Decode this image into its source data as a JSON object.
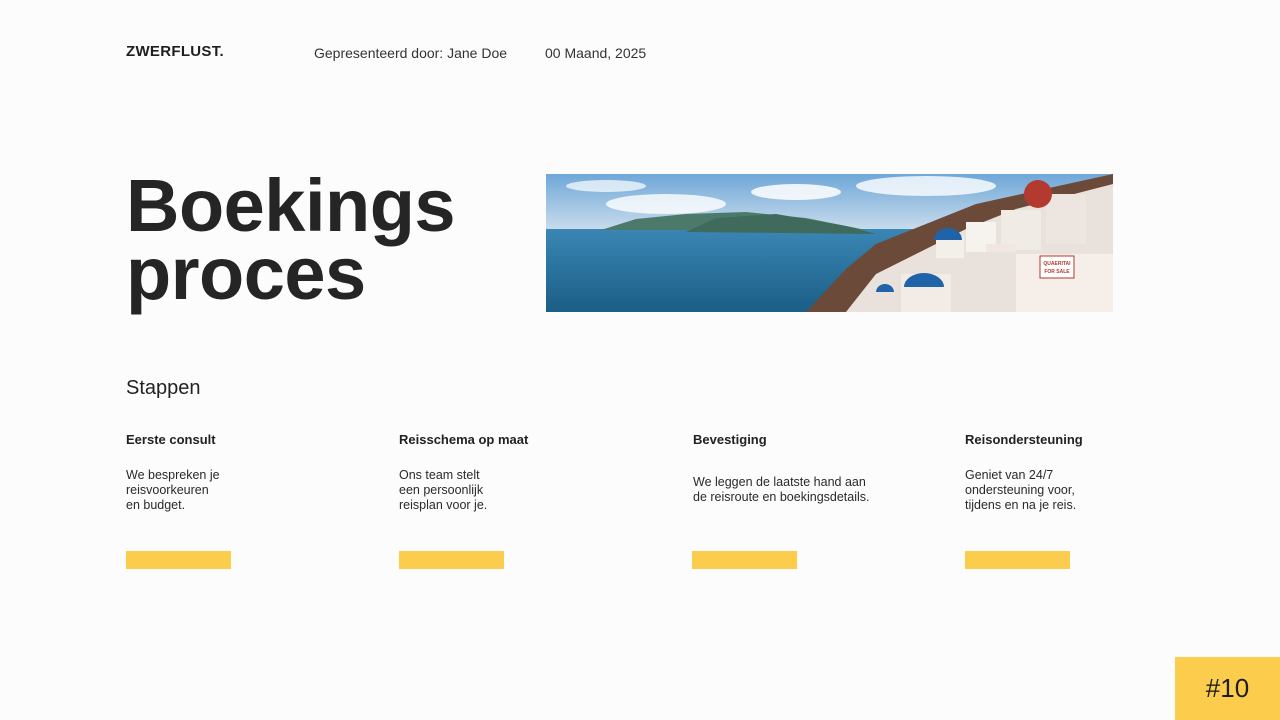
{
  "header": {
    "brand": "ZWERFLUST.",
    "presenter": "Gepresenteerd door: Jane Doe",
    "date": "00 Maand, 2025"
  },
  "title": {
    "line1": "Boekings",
    "line2": "proces"
  },
  "hero_image": {
    "sign_line1": "QUAERITAI",
    "sign_line2": "FOR SALE"
  },
  "steps_section": {
    "title": "Stappen",
    "steps": [
      {
        "heading": "Eerste consult",
        "description": "We bespreken je\nreisvoorkeuren\nen budget."
      },
      {
        "heading": "Reisschema op maat",
        "description": "Ons team stelt\neen persoonlijk\nreisplan voor je."
      },
      {
        "heading": "Bevestiging",
        "description": "We leggen de laatste hand aan\nde reisroute en boekingsdetails."
      },
      {
        "heading": "Reisondersteuning",
        "description": "Geniet van 24/7\nondersteuning voor,\ntijdens en na je reis."
      }
    ]
  },
  "page_number": "#10",
  "colors": {
    "accent": "#fccd4c",
    "text": "#252525",
    "background": "#fdfcfc"
  }
}
